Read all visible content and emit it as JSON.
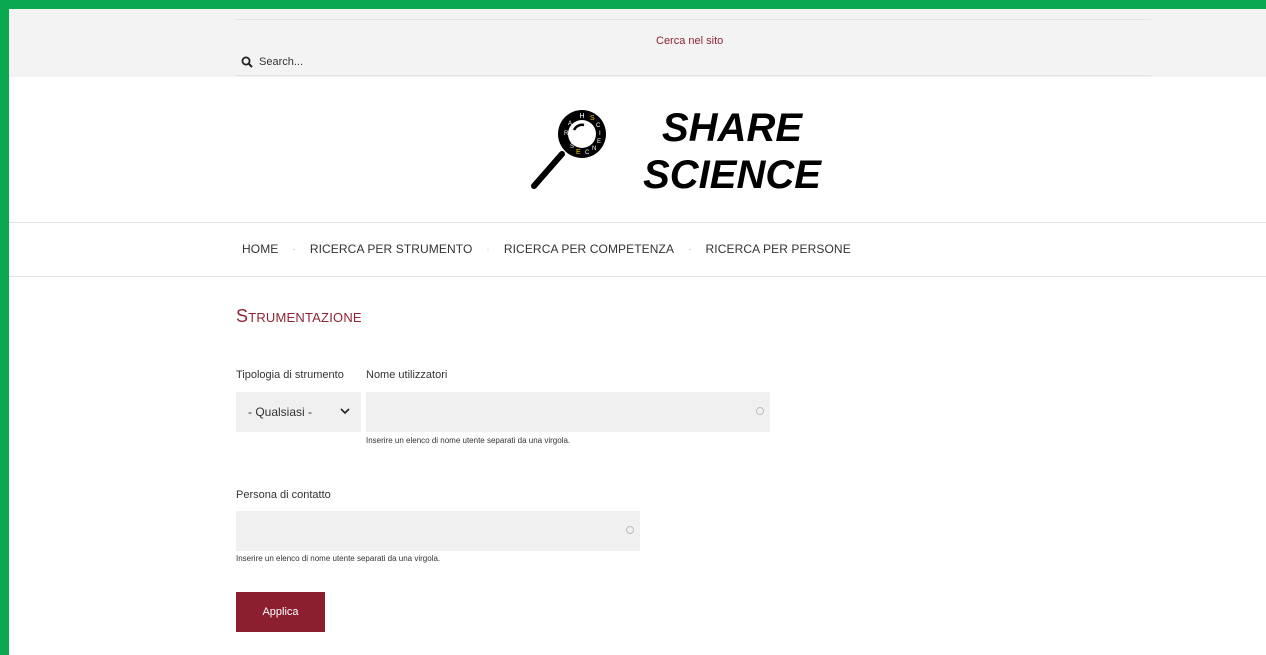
{
  "header": {
    "search_title": "Cerca nel sito",
    "search_placeholder": "Search...",
    "logo_line1": "SHARE",
    "logo_line2": "SCIENCE",
    "logo_ring_letters": [
      "R",
      "A",
      "H",
      "S",
      "S",
      "C",
      "I",
      "E",
      "N",
      "C",
      "E"
    ]
  },
  "nav": {
    "items": [
      "HOME",
      "RICERCA PER STRUMENTO",
      "RICERCA PER COMPETENZA",
      "RICERCA PER PERSONE"
    ]
  },
  "main": {
    "title": "Strumentazione",
    "filters": {
      "tipologia_label": "Tipologia di strumento",
      "tipologia_value": "- Qualsiasi -",
      "utilizzatori_label": "Nome utilizzatori",
      "utilizzatori_value": "",
      "utilizzatori_hint": "Inserire un elenco di nome utente separati da una virgola.",
      "contatto_label": "Persona di contatto",
      "contatto_value": "",
      "contatto_hint": "Inserire un elenco di nome utente separati da una virgola."
    },
    "apply_label": "Applica"
  },
  "colors": {
    "accent": "#8e2433",
    "button": "#8b1e2f",
    "frame": "#0aa84f",
    "logo_yellow": "#f2d100"
  }
}
